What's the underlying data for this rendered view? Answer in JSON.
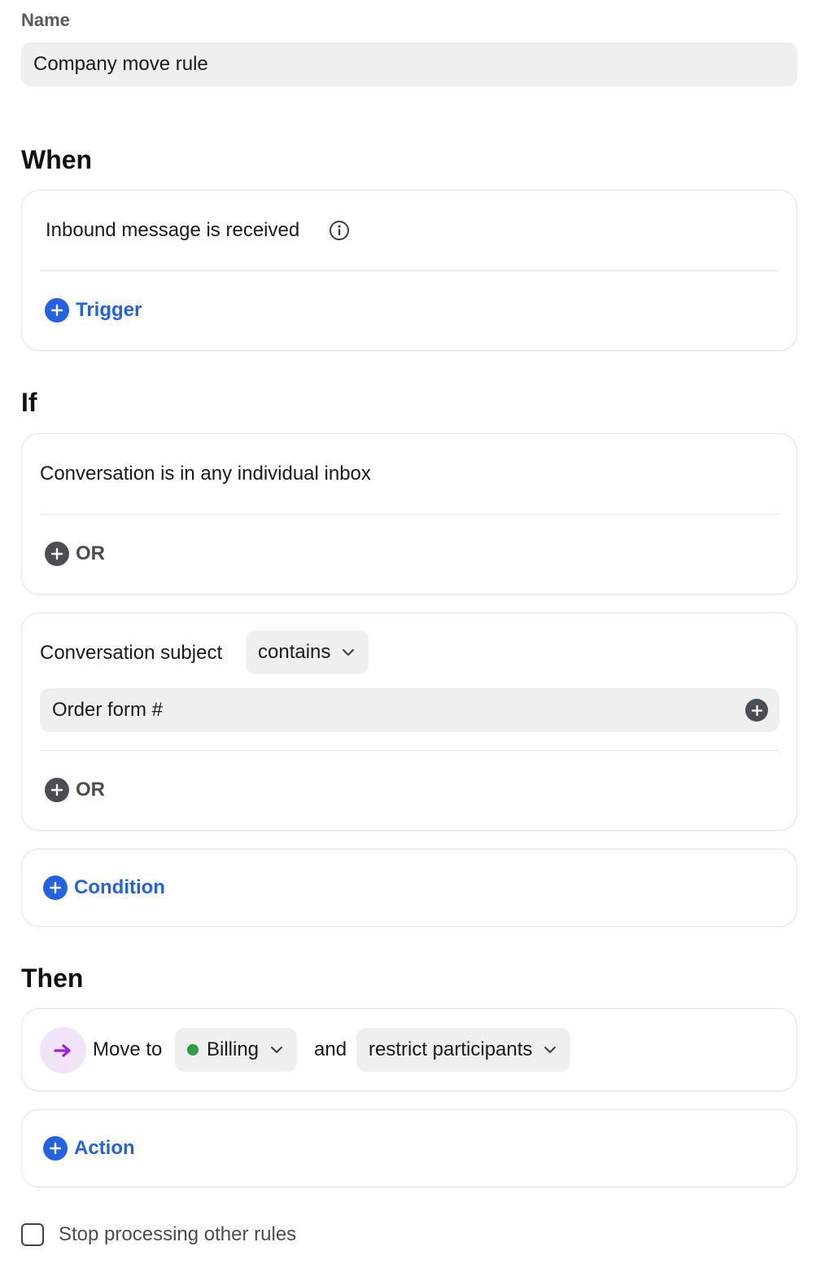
{
  "name_field": {
    "label": "Name",
    "value": "Company move rule"
  },
  "when": {
    "title": "When",
    "trigger_text": "Inbound message is received",
    "add_trigger_label": "Trigger"
  },
  "if": {
    "title": "If",
    "condition_1": {
      "text": "Conversation is in any individual inbox",
      "or_label": "OR"
    },
    "condition_2": {
      "field": "Conversation subject",
      "operator": "contains",
      "value": "Order form #",
      "or_label": "OR"
    },
    "add_condition_label": "Condition"
  },
  "then": {
    "title": "Then",
    "action": {
      "verb": "Move to",
      "destination": "Billing",
      "destination_color": "#2f9a47",
      "connector": "and",
      "option": "restrict participants",
      "icon": "arrow-right-icon",
      "icon_color": "#a020d8"
    },
    "add_action_label": "Action"
  },
  "stop_processing": {
    "label": "Stop processing other rules",
    "checked": false
  },
  "colors": {
    "accent": "#2462e3",
    "neutral_icon": "#4a4d52"
  }
}
